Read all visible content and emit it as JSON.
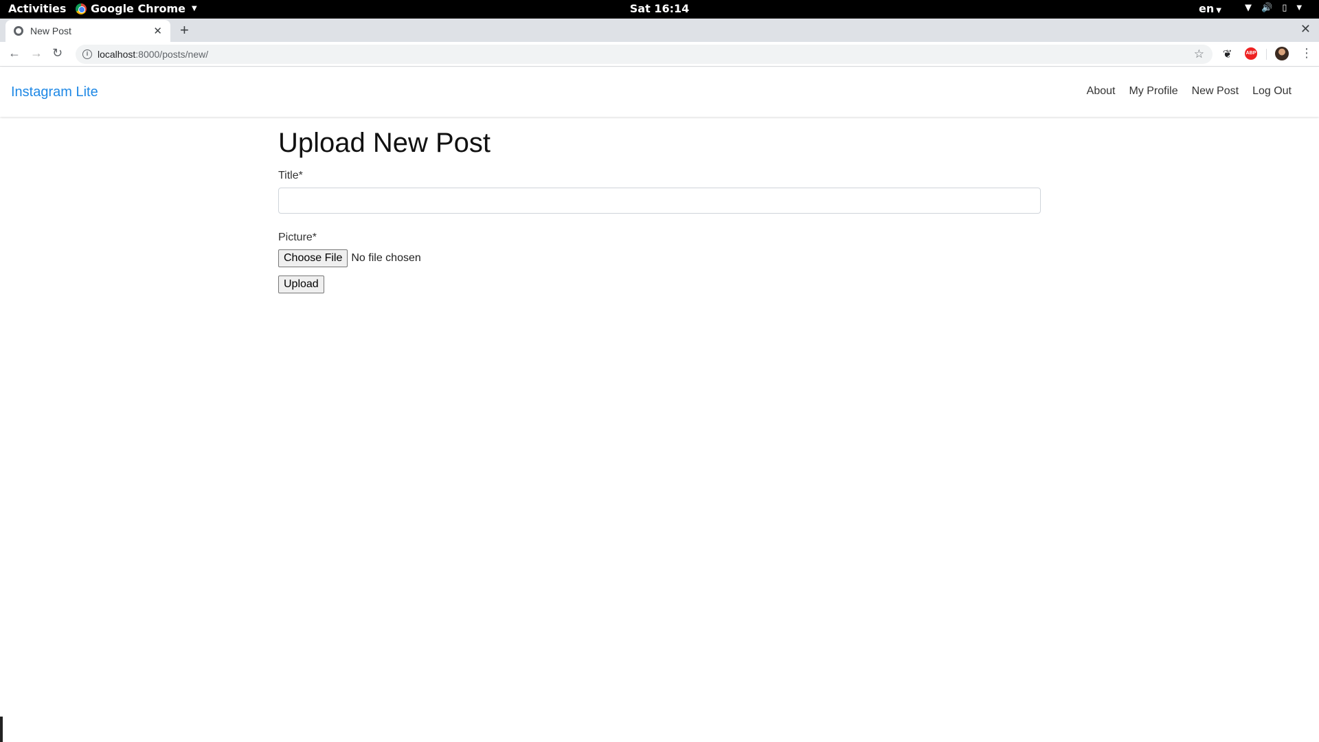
{
  "os_bar": {
    "activities": "Activities",
    "app_name": "Google Chrome",
    "clock": "Sat 16:14",
    "language": "en"
  },
  "browser": {
    "tab_title": "New Post",
    "url_host": "localhost",
    "url_path": ":8000/posts/new/",
    "extension_abp": "ABP"
  },
  "navbar": {
    "brand": "Instagram Lite",
    "brand_color": "#1e88e5",
    "links": [
      "About",
      "My Profile",
      "New Post",
      "Log Out"
    ]
  },
  "form": {
    "heading": "Upload New Post",
    "title_label": "Title*",
    "title_value": "",
    "picture_label": "Picture*",
    "choose_file_label": "Choose File",
    "file_status": "No file chosen",
    "upload_label": "Upload"
  }
}
